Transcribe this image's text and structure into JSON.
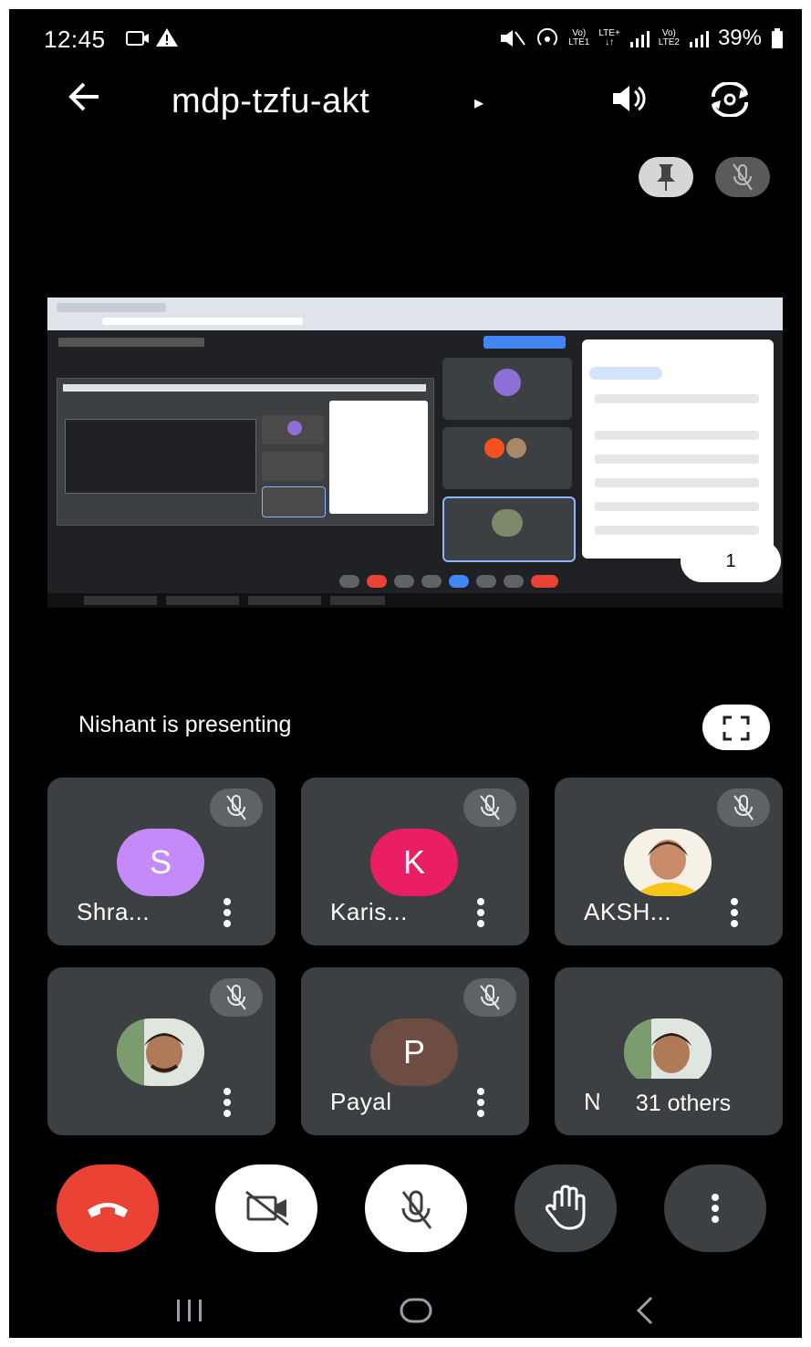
{
  "status_bar": {
    "time": "12:45",
    "left_icons": [
      "screen-record-icon",
      "warning-icon"
    ],
    "net_label_1": "Vo)",
    "net_label_1b": "LTE1",
    "net_label_2": "LTE+",
    "net_label_2b": "↓↑",
    "net_label_3": "Vo)",
    "net_label_3b": "LTE2",
    "battery": "39%"
  },
  "app_bar": {
    "meeting_code": "mdp-tzfu-akt",
    "caret": "▸"
  },
  "stage": {
    "presenting_text": "Nishant is presenting",
    "participant_count": "1"
  },
  "participants": [
    {
      "name": "Shra...",
      "initial": "S",
      "color": "#c58af9",
      "muted": true
    },
    {
      "name": "Karis...",
      "initial": "K",
      "color": "#e91e63",
      "muted": true
    },
    {
      "name": "AKSH...",
      "initial": "",
      "color": "#f5c518",
      "muted": true
    },
    {
      "name": "",
      "initial": "",
      "color": "#6b8e6b",
      "muted": true
    },
    {
      "name": "Payal",
      "initial": "P",
      "color": "#6d4c41",
      "muted": true
    },
    {
      "name": "Ni",
      "initial": "",
      "color": "#6b8e6b",
      "muted": false,
      "others_label": "31 others"
    }
  ],
  "colors": {
    "end_call": "#ea4335",
    "tile_bg": "#3c4043",
    "control_dark": "#3c4043",
    "control_light": "#ffffff"
  }
}
